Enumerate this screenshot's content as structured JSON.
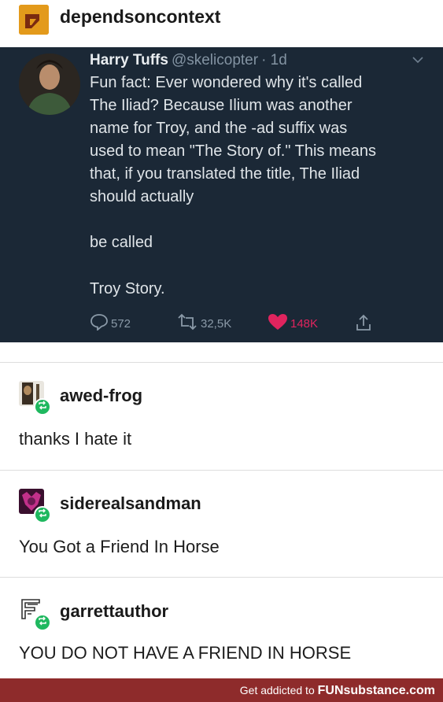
{
  "post": {
    "blog_name": "dependsoncontext"
  },
  "tweet": {
    "author_name": "Harry Tuffs",
    "handle": "@skelicopter",
    "time": "· 1d",
    "lines": [
      "Fun fact: Ever wondered why it's called",
      "The Iliad? Because Ilium was another",
      "name for Troy, and the -ad suffix was",
      "used to mean \"The Story of.\" This means",
      "that, if you translated the title, The Iliad",
      "should actually",
      "be called",
      "Troy Story."
    ],
    "replies_count": "572",
    "retweets_count": "32,5K",
    "likes_count": "148K",
    "like_color": "#e0245e"
  },
  "reblogs": [
    {
      "username": "awed-frog",
      "text": "thanks I hate it"
    },
    {
      "username": "siderealsandman",
      "text": "You Got a Friend In Horse"
    },
    {
      "username": "garrettauthor",
      "text": "YOU DO NOT HAVE A FRIEND IN HORSE"
    }
  ],
  "footer": {
    "tagline": "Get addicted to",
    "brand": "FUNsubstance.com"
  },
  "icons": {
    "reply": "speech-bubble-icon",
    "retweet": "retweet-icon",
    "like": "heart-icon",
    "share": "share-icon",
    "reblog_badge": "reblog-icon"
  }
}
